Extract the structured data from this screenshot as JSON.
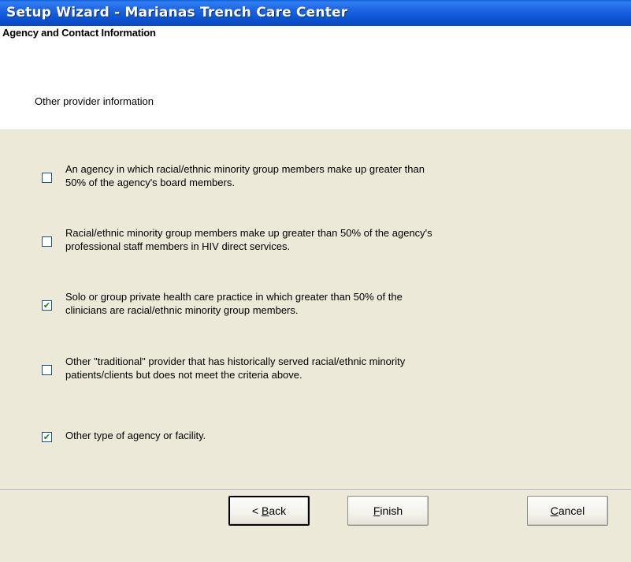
{
  "window": {
    "title": "Setup Wizard - Marianas Trench Care Center"
  },
  "header": {
    "heading": "Agency and Contact Information",
    "subheading": "Other provider information"
  },
  "options": [
    {
      "line1": "An agency in which racial/ethnic minority group members make up greater than",
      "line2": "50% of the agency's board members.",
      "checked": false
    },
    {
      "line1": "Racial/ethnic minority group members make up greater than 50% of the agency's",
      "line2": "professional staff members in HIV direct services.",
      "checked": false
    },
    {
      "line1": "Solo or group private health care practice in which greater than 50% of the",
      "line2": "clinicians are racial/ethnic minority group members.",
      "checked": true
    },
    {
      "line1": "Other \"traditional\" provider that has historically served racial/ethnic minority",
      "line2": "patients/clients but does not meet the criteria above.",
      "checked": false
    },
    {
      "line1": "Other type of agency or facility.",
      "line2": "",
      "checked": true
    }
  ],
  "buttons": {
    "back_label": "< Back",
    "finish_label": "Finish",
    "cancel_label": "Cancel"
  },
  "colors": {
    "titlebar": "#0b52d0",
    "dialog_bg": "#ece9d8",
    "header_bg": "#ffffff",
    "check_mark": "#1f7c1f"
  }
}
